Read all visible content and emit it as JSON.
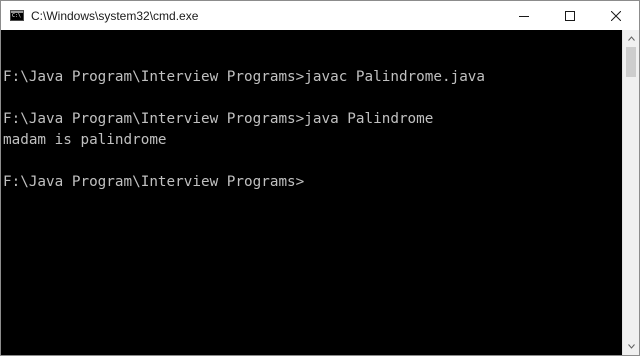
{
  "window": {
    "title": "C:\\Windows\\system32\\cmd.exe",
    "icon": "cmd-icon",
    "icon_text": "C:\\"
  },
  "controls": {
    "minimize": "minimize-icon",
    "maximize": "maximize-icon",
    "close": "close-icon"
  },
  "console": {
    "lines": [
      "",
      "F:\\Java Program\\Interview Programs>javac Palindrome.java",
      "",
      "F:\\Java Program\\Interview Programs>java Palindrome",
      "madam is palindrome",
      "",
      "F:\\Java Program\\Interview Programs>"
    ]
  },
  "colors": {
    "console_bg": "#000000",
    "console_text": "#c0c0c0",
    "titlebar_bg": "#ffffff"
  }
}
